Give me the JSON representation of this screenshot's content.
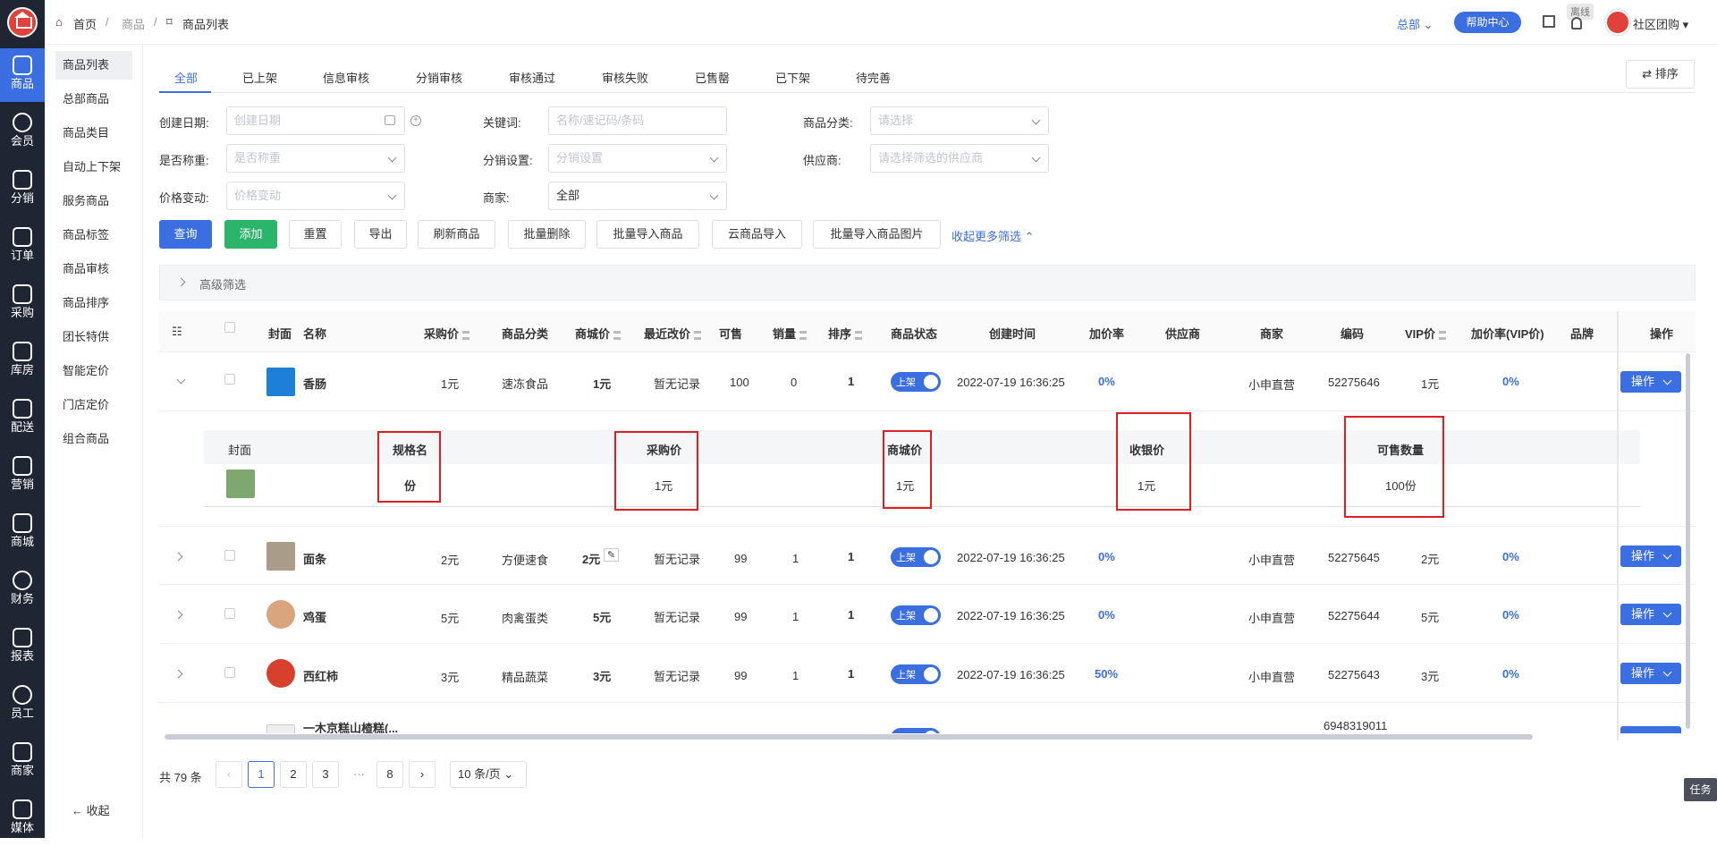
{
  "rail": [
    "商品",
    "会员",
    "分销",
    "订单",
    "采购",
    "库房",
    "配送",
    "营销",
    "商城",
    "财务",
    "报表",
    "员工",
    "商家",
    "媒体"
  ],
  "subnav": {
    "items": [
      "商品列表",
      "总部商品",
      "商品类目",
      "自动上下架",
      "服务商品",
      "商品标签",
      "商品审核",
      "商品排序",
      "团长特供",
      "智能定价",
      "门店定价",
      "组合商品"
    ],
    "collapse": "收起"
  },
  "topbar": {
    "breadcrumb": [
      "首页",
      "/",
      "商品",
      "/",
      "商品列表"
    ],
    "hq": "总部",
    "help": "帮助中心",
    "offline": "离线",
    "user": "社区团购"
  },
  "tabs": [
    "全部",
    "已上架",
    "信息审核",
    "分销审核",
    "审核通过",
    "审核失败",
    "已售罄",
    "已下架",
    "待完善"
  ],
  "sort_button": "排序",
  "filters": {
    "create_date": {
      "label": "创建日期:",
      "placeholder": "创建日期"
    },
    "keyword": {
      "label": "关键词:",
      "placeholder": "名称/速记码/条码"
    },
    "category": {
      "label": "商品分类:",
      "placeholder": "请选择"
    },
    "weighing": {
      "label": "是否称重:",
      "placeholder": "是否称重"
    },
    "distribution": {
      "label": "分销设置:",
      "placeholder": "分销设置"
    },
    "supplier": {
      "label": "供应商:",
      "placeholder": "请选择筛选的供应商"
    },
    "price_change": {
      "label": "价格变动:",
      "placeholder": "价格变动"
    },
    "merchant": {
      "label": "商家:",
      "value": "全部"
    }
  },
  "buttons": [
    "查询",
    "添加",
    "重置",
    "导出",
    "刷新商品",
    "批量删除",
    "批量导入商品",
    "云商品导入",
    "批量导入商品图片"
  ],
  "more_filters": "收起更多筛选",
  "advanced": "高级筛选",
  "table": {
    "headers": [
      "封面",
      "名称",
      "采购价",
      "商品分类",
      "商城价",
      "最近改价",
      "可售",
      "销量",
      "排序",
      "商品状态",
      "创建时间",
      "加价率",
      "供应商",
      "商家",
      "编码",
      "VIP价",
      "加价率(VIP价)",
      "品牌",
      "操作"
    ],
    "rows": [
      {
        "name": "香肠",
        "cost": "1元",
        "category": "速冻食品",
        "mall_price": "1元",
        "last_change": "暂无记录",
        "stock": "100",
        "sales": "0",
        "sort": "1",
        "status": "上架",
        "created": "2022-07-19 16:36:25",
        "markup": "0%",
        "merchant": "小申直营",
        "code": "52275646",
        "vip": "1元",
        "vip_markup": "0%",
        "op": "操作"
      },
      {
        "name": "面条",
        "cost": "2元",
        "category": "方便速食",
        "mall_price": "2元",
        "last_change": "暂无记录",
        "stock": "99",
        "sales": "1",
        "sort": "1",
        "status": "上架",
        "created": "2022-07-19 16:36:25",
        "markup": "0%",
        "merchant": "小申直营",
        "code": "52275645",
        "vip": "2元",
        "vip_markup": "0%",
        "op": "操作"
      },
      {
        "name": "鸡蛋",
        "cost": "5元",
        "category": "肉禽蛋类",
        "mall_price": "5元",
        "last_change": "暂无记录",
        "stock": "99",
        "sales": "1",
        "sort": "1",
        "status": "上架",
        "created": "2022-07-19 16:36:25",
        "markup": "0%",
        "merchant": "小申直营",
        "code": "52275644",
        "vip": "5元",
        "vip_markup": "0%",
        "op": "操作"
      },
      {
        "name": "西红柿",
        "cost": "3元",
        "category": "精品蔬菜",
        "mall_price": "3元",
        "last_change": "暂无记录",
        "stock": "99",
        "sales": "1",
        "sort": "1",
        "status": "上架",
        "created": "2022-07-19 16:36:25",
        "markup": "50%",
        "merchant": "小申直营",
        "code": "52275643",
        "vip": "3元",
        "vip_markup": "0%",
        "op": "操作"
      },
      {
        "name": "一木京糕山楂糕(...",
        "code": "6948319011"
      }
    ],
    "sub": {
      "headers": [
        "封面",
        "规格名",
        "采购价",
        "商城价",
        "收银价",
        "可售数量"
      ],
      "row": {
        "spec": "份",
        "cost": "1元",
        "mall": "1元",
        "cashier": "1元",
        "qty": "100份"
      }
    }
  },
  "pager": {
    "total": "共 79 条",
    "pages": [
      "1",
      "2",
      "3",
      "8"
    ],
    "dots": "···",
    "size": "10 条/页"
  },
  "task": "任务",
  "colors": {
    "primary": "#3b6ee0",
    "success": "#2bb56a",
    "rail": "#1f2533",
    "highlight": "#e02020"
  }
}
